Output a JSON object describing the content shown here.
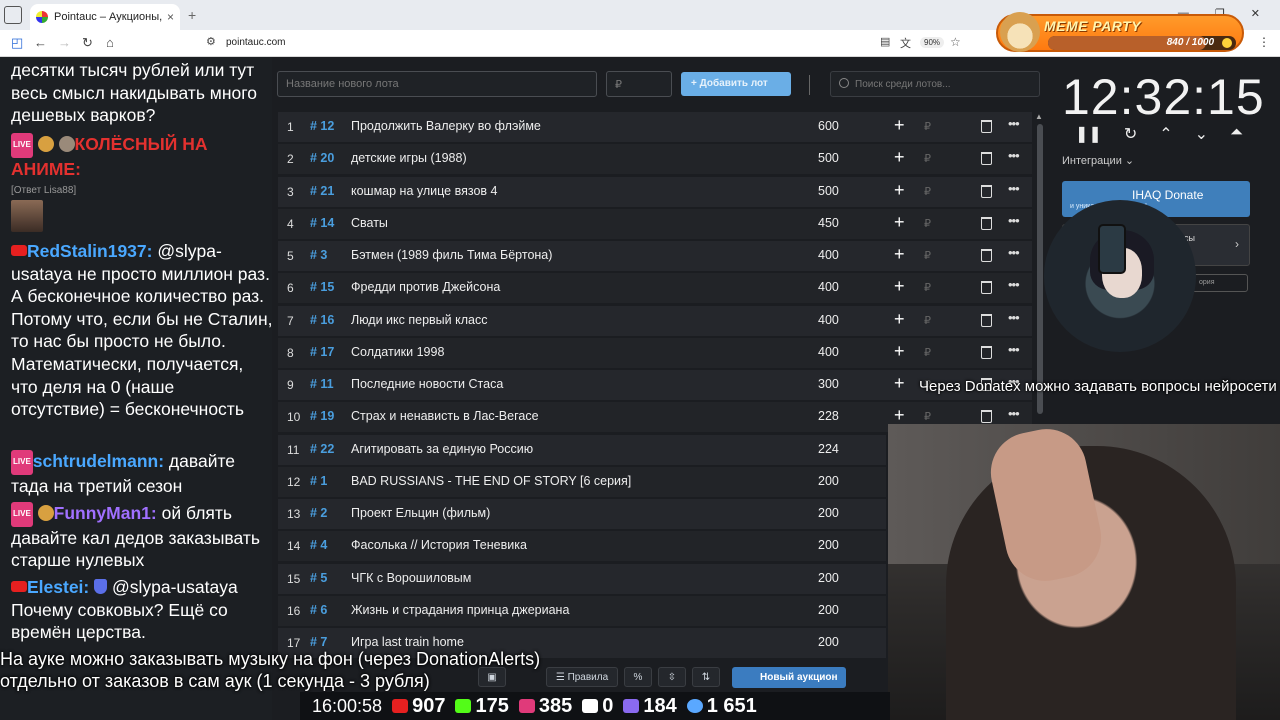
{
  "browser": {
    "tab_title": "Pointauc – Аукционы, лотереи",
    "tab_close": "×",
    "new_tab": "+",
    "url": "pointauc.com",
    "zoom": "90%"
  },
  "meme_party": {
    "title": "MEME PARTY",
    "count": "840 / 1000",
    "progress": 0.84
  },
  "chat": {
    "messages": [
      {
        "text": "десятки тысяч рублей или тут весь смысл накидывать много дешевых варков?"
      },
      {
        "badge": "LIVE",
        "nick": "КОЛЁСНЫЙ НА АНИМЕ:",
        "nick_color": "#e3312f",
        "reply": "[Ответ Lisa88]"
      },
      {
        "nick": "RedStalin1937:",
        "nick_color": "#4aa8ff",
        "text": " @slypa-usataya не просто миллион раз. А бесконечное количество раз. Потому что, если бы не Сталин, то нас бы просто не было. Математически, получается, что деля на 0 (наше отсутствие) = бесконечность"
      },
      {
        "badge": "LIVE",
        "nick": "schtrudelmann:",
        "nick_color": "#4aa8ff",
        "text": " давайте тада на третий сезон"
      },
      {
        "badge": "LIVE",
        "nick": "FunnyMan1:",
        "nick_color": "#a070ff",
        "text": " ой блять давайте кал дедов заказывать старше нулевых"
      },
      {
        "nick": "Elestei:",
        "nick_color": "#4aa8ff",
        "text": " @slypa-usataya Почему совковых? Ещё со времён церства."
      }
    ]
  },
  "toolbar": {
    "lot_placeholder": "Название нового лота",
    "amount_placeholder": "₽",
    "add_button": "+ Добавить лот",
    "search_placeholder": "Поиск среди лотов..."
  },
  "lots": [
    {
      "idx": "1",
      "id": "# 12",
      "name": "Продолжить Валерку во флэйме",
      "amount": "600"
    },
    {
      "idx": "2",
      "id": "# 20",
      "name": "детские игры (1988)",
      "amount": "500"
    },
    {
      "idx": "3",
      "id": "# 21",
      "name": "кошмар на улице вязов 4",
      "amount": "500"
    },
    {
      "idx": "4",
      "id": "# 14",
      "name": "Сваты",
      "amount": "450"
    },
    {
      "idx": "5",
      "id": "# 3",
      "name": "Бэтмен (1989 филь Тима Бёртона)",
      "amount": "400"
    },
    {
      "idx": "6",
      "id": "# 15",
      "name": "Фредди против Джейсона",
      "amount": "400"
    },
    {
      "idx": "7",
      "id": "# 16",
      "name": "Люди икс первый класс",
      "amount": "400"
    },
    {
      "idx": "8",
      "id": "# 17",
      "name": "Солдатики 1998",
      "amount": "400"
    },
    {
      "idx": "9",
      "id": "# 11",
      "name": "Последние новости Стаса",
      "amount": "300"
    },
    {
      "idx": "10",
      "id": "# 19",
      "name": "Страх и ненависть в Лас-Вегасе",
      "amount": "228"
    },
    {
      "idx": "11",
      "id": "# 22",
      "name": "Агитировать за единую Россию",
      "amount": "224"
    },
    {
      "idx": "12",
      "id": "# 1",
      "name": "BAD RUSSIANS - THE END OF STORY [6 серия]",
      "amount": "200"
    },
    {
      "idx": "13",
      "id": "# 2",
      "name": "Проект Ельцин (фильм)",
      "amount": "200"
    },
    {
      "idx": "14",
      "id": "# 4",
      "name": "Фасолька // История Теневика",
      "amount": "200"
    },
    {
      "idx": "15",
      "id": "# 5",
      "name": "ЧГК с Ворошиловым",
      "amount": "200"
    },
    {
      "idx": "16",
      "id": "# 6",
      "name": "Жизнь и страдания принца джериана",
      "amount": "200"
    },
    {
      "idx": "17",
      "id": "# 7",
      "name": "Игра last train home",
      "amount": "200"
    }
  ],
  "row_icons": {
    "plus": "+",
    "rub": "₽",
    "more": "•••"
  },
  "timer": {
    "value": "12:32:15",
    "integrations_label": "Интеграции",
    "donate_label": "IHAQ Donate",
    "donate_sub": "и уникальные виджеты!",
    "donatex_label": "исы",
    "history_label": "ория"
  },
  "overlay": {
    "donatex_text": "Через Donatex можно задавать вопросы нейросети",
    "sub_line1": "На ауке можно заказывать музыку на фон (через DonationAlerts)",
    "sub_line2": "отдельно от заказов в сам аук (1 секунда - 3 рубля)"
  },
  "bottom": {
    "rules": "Правила",
    "percent": "%",
    "new_auction": "Новый аукцион"
  },
  "stats": {
    "clock": "16:00:58",
    "youtube": "907",
    "kick": "175",
    "vk": "385",
    "rumble": "0",
    "trovo": "184",
    "total": "1 651"
  },
  "colors": {
    "accent": "#4a9ede",
    "add_button": "#6aaee6",
    "new_auction": "#3b7cc0",
    "row_bg": "#25272c"
  }
}
